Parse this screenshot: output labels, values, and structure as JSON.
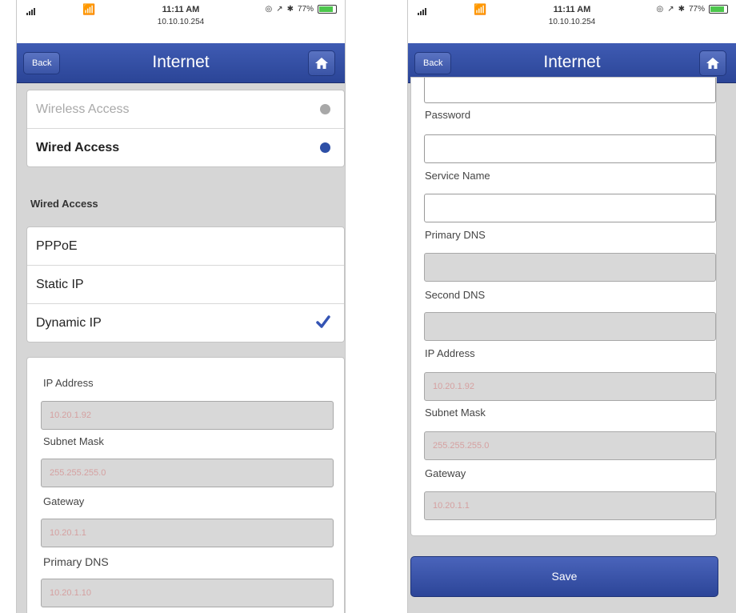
{
  "status_bar": {
    "time": "11:11 AM",
    "address": "10.10.10.254",
    "right_text": "77%",
    "battery_level": 0.77
  },
  "navbar": {
    "back_label": "Back",
    "title": "Internet"
  },
  "left_screen": {
    "access_options": [
      {
        "label": "Wireless Access",
        "selected": false
      },
      {
        "label": "Wired Access",
        "selected": true
      }
    ],
    "section_title": "Wired Access",
    "connection_types": [
      {
        "label": "PPPoE",
        "selected": false
      },
      {
        "label": "Static IP",
        "selected": false
      },
      {
        "label": "Dynamic IP",
        "selected": true
      }
    ],
    "fields": [
      {
        "label": "IP Address",
        "value": "10.20.1.92"
      },
      {
        "label": "Subnet Mask",
        "value": "255.255.255.0"
      },
      {
        "label": "Gateway",
        "value": "10.20.1.1"
      },
      {
        "label": "Primary DNS",
        "value": "10.20.1.10"
      }
    ]
  },
  "right_screen": {
    "fields": [
      {
        "label": "Password",
        "value": ""
      },
      {
        "label": "Service Name",
        "value": ""
      },
      {
        "label": "Primary DNS",
        "value": ""
      },
      {
        "label": "Second DNS",
        "value": ""
      },
      {
        "label": "IP Address",
        "value": "10.20.1.92"
      },
      {
        "label": "Subnet Mask",
        "value": "255.255.255.0"
      },
      {
        "label": "Gateway",
        "value": "10.20.1.1"
      }
    ],
    "save_label": "Save"
  },
  "colors": {
    "nav_blue": "#2f4a9e",
    "selected_dot": "#2d4fa6",
    "unselected_dot": "#a8a8a8",
    "check_blue": "#3454b4",
    "disabled_input": "#d8d8d8"
  }
}
